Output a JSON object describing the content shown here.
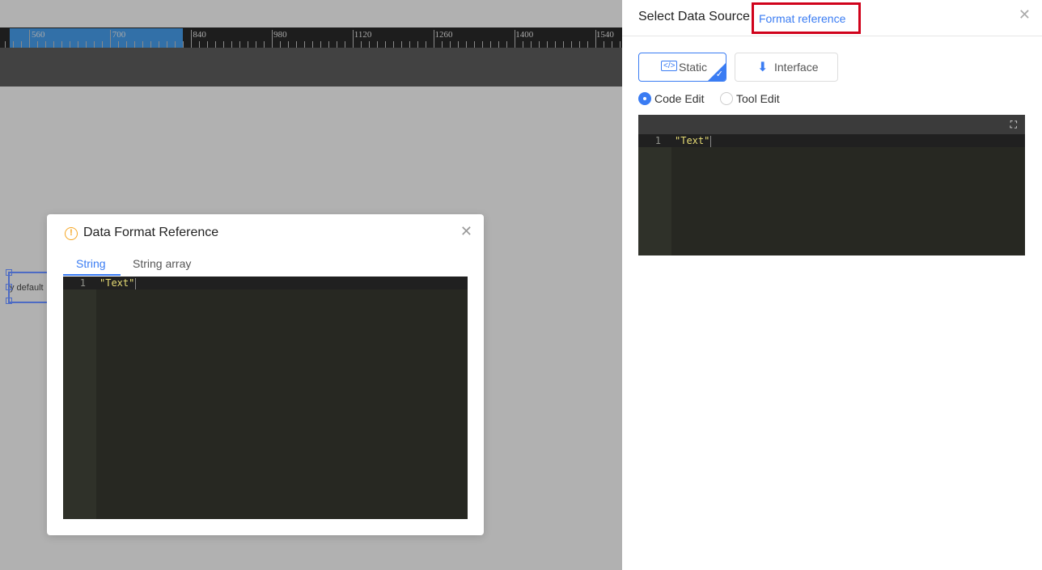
{
  "ruler": {
    "labels": [
      "560",
      "700",
      "840",
      "980",
      "1120",
      "1260",
      "1400",
      "1540"
    ]
  },
  "canvas": {
    "widget_text": "y default"
  },
  "modal": {
    "title": "Data Format Reference",
    "icon": "warning-icon",
    "tabs": [
      {
        "label": "String",
        "active": true
      },
      {
        "label": "String array",
        "active": false
      }
    ],
    "editor": {
      "line": "1",
      "code": "\"Text\""
    }
  },
  "panel": {
    "title": "Select Data Source",
    "format_link": "Format reference",
    "sources": [
      {
        "label": "Static",
        "icon": "code-icon",
        "selected": true
      },
      {
        "label": "Interface",
        "icon": "download-icon",
        "selected": false
      }
    ],
    "modes": [
      {
        "label": "Code Edit",
        "checked": true
      },
      {
        "label": "Tool Edit",
        "checked": false
      }
    ],
    "editor": {
      "line": "1",
      "code": "\"Text\""
    }
  },
  "colors": {
    "accent": "#3a7cf3",
    "highlight": "#d0021b",
    "editor_bg": "#272822",
    "string": "#e6db74"
  }
}
